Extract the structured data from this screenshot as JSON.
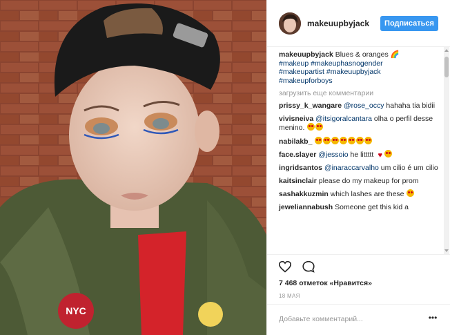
{
  "post": {
    "username": "makeuupbyjack",
    "follow_label": "Подписаться",
    "caption_user": "makeuupbyjack",
    "caption_text": " Blues & oranges 🌈 ",
    "caption_tags": "#makeup #makeuphasnogender #makeupartist #makeuupbyjack #makeupforboys",
    "load_more": "загрузить еще комментарии",
    "comments": [
      {
        "user": "prissy_k_wangare",
        "mention": "@rose_occy",
        "text": " hahaha tia bidii"
      },
      {
        "user": "vivisneiva",
        "mention": "@itsigoralcantara",
        "text": " olha o perfil desse menino."
      },
      {
        "user": "nabilakb_",
        "mention": "",
        "text": ""
      },
      {
        "user": "face.slayer",
        "mention": "@jessoio",
        "text": " he littttt"
      },
      {
        "user": "ingridsantos",
        "mention": "@inaraccarvalho",
        "text": " um cilio é um cilio"
      },
      {
        "user": "kaitsinclair",
        "mention": "",
        "text": " please do my makeup for prom"
      },
      {
        "user": "sashakkuzmin",
        "mention": "",
        "text": " which lashes are these"
      },
      {
        "user": "jeweliannabush",
        "mention": "",
        "text": " Someone get this kid a"
      }
    ],
    "likes": "7 468 отметок «Нравится»",
    "date": "18 МАЯ",
    "comment_placeholder": "Добавьте комментарий...",
    "more_label": "•••"
  },
  "photo": {
    "patch_text": "NYC"
  },
  "icons": [
    "heart-icon",
    "comment-icon",
    "more-icon"
  ],
  "colors": {
    "accent": "#3897f0",
    "hashtag": "#003569",
    "muted": "#999999"
  }
}
